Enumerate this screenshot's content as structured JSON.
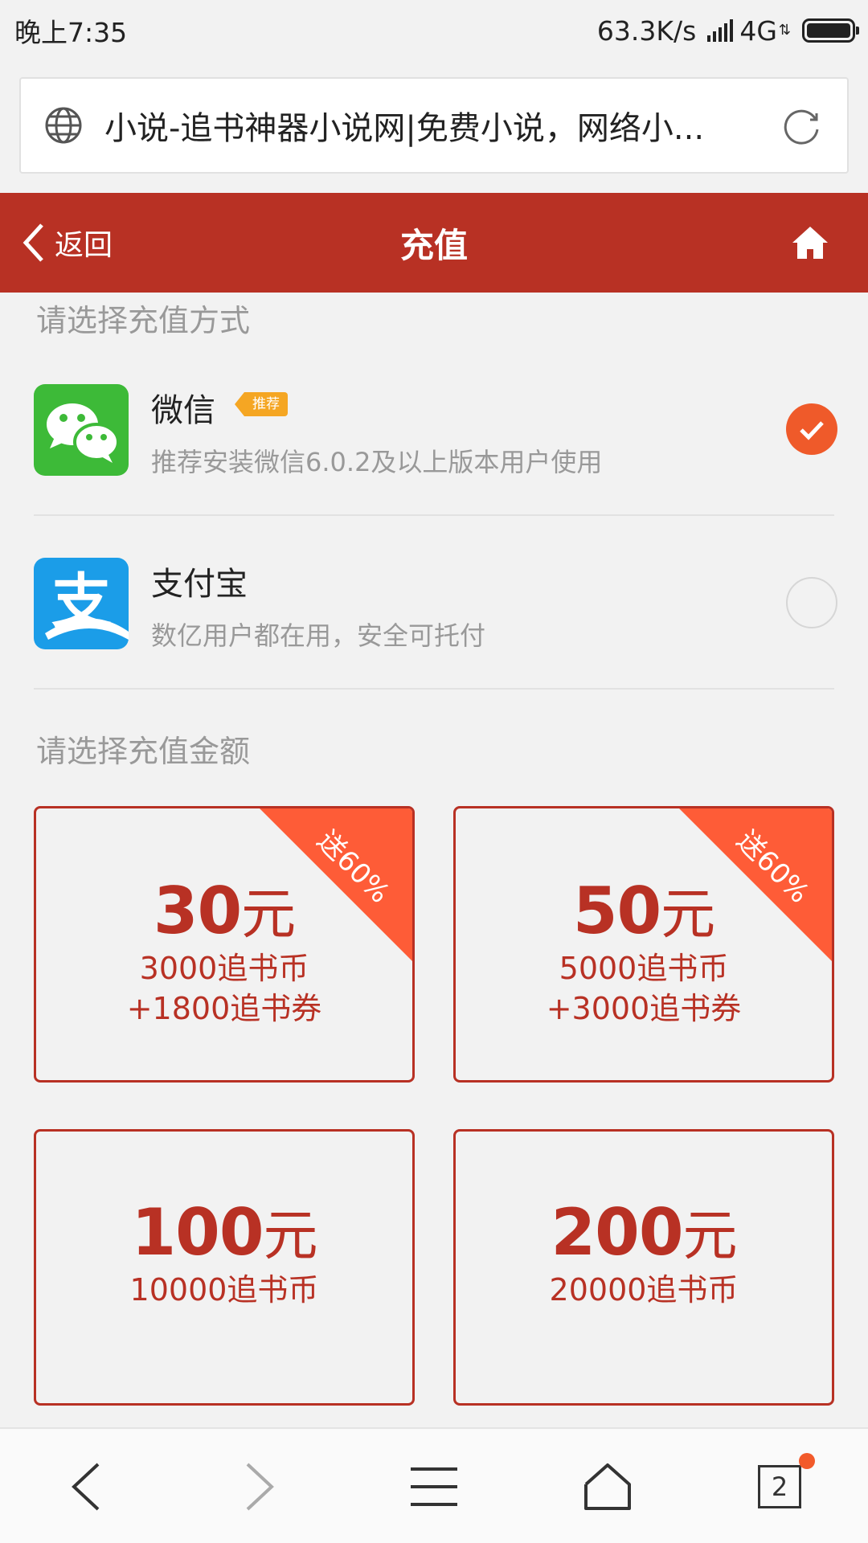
{
  "status_bar": {
    "time": "晚上7:35",
    "speed": "63.3K/s",
    "network": "4G"
  },
  "url_bar": {
    "title": "小说-追书神器小说网|免费小说，网络小..."
  },
  "header": {
    "back_label": "返回",
    "title": "充值",
    "accent_color": "#b83124"
  },
  "payment": {
    "section_label": "请选择充值方式",
    "methods": [
      {
        "name": "微信",
        "badge": "推荐",
        "desc": "推荐安装微信6.0.2及以上版本用户使用",
        "selected": true,
        "icon": "wechat-icon"
      },
      {
        "name": "支付宝",
        "desc": "数亿用户都在用，安全可托付",
        "selected": false,
        "icon": "alipay-icon"
      }
    ]
  },
  "amount": {
    "section_label": "请选择充值金额",
    "options": [
      {
        "value": "30",
        "unit": "元",
        "coins": "3000追书币",
        "bonus": "+1800追书券",
        "corner": "送60%"
      },
      {
        "value": "50",
        "unit": "元",
        "coins": "5000追书币",
        "bonus": "+3000追书券",
        "corner": "送60%"
      },
      {
        "value": "100",
        "unit": "元",
        "coins": "10000追书币"
      },
      {
        "value": "200",
        "unit": "元",
        "coins": "20000追书币"
      }
    ]
  },
  "bottom_nav": {
    "tab_count": "2"
  }
}
